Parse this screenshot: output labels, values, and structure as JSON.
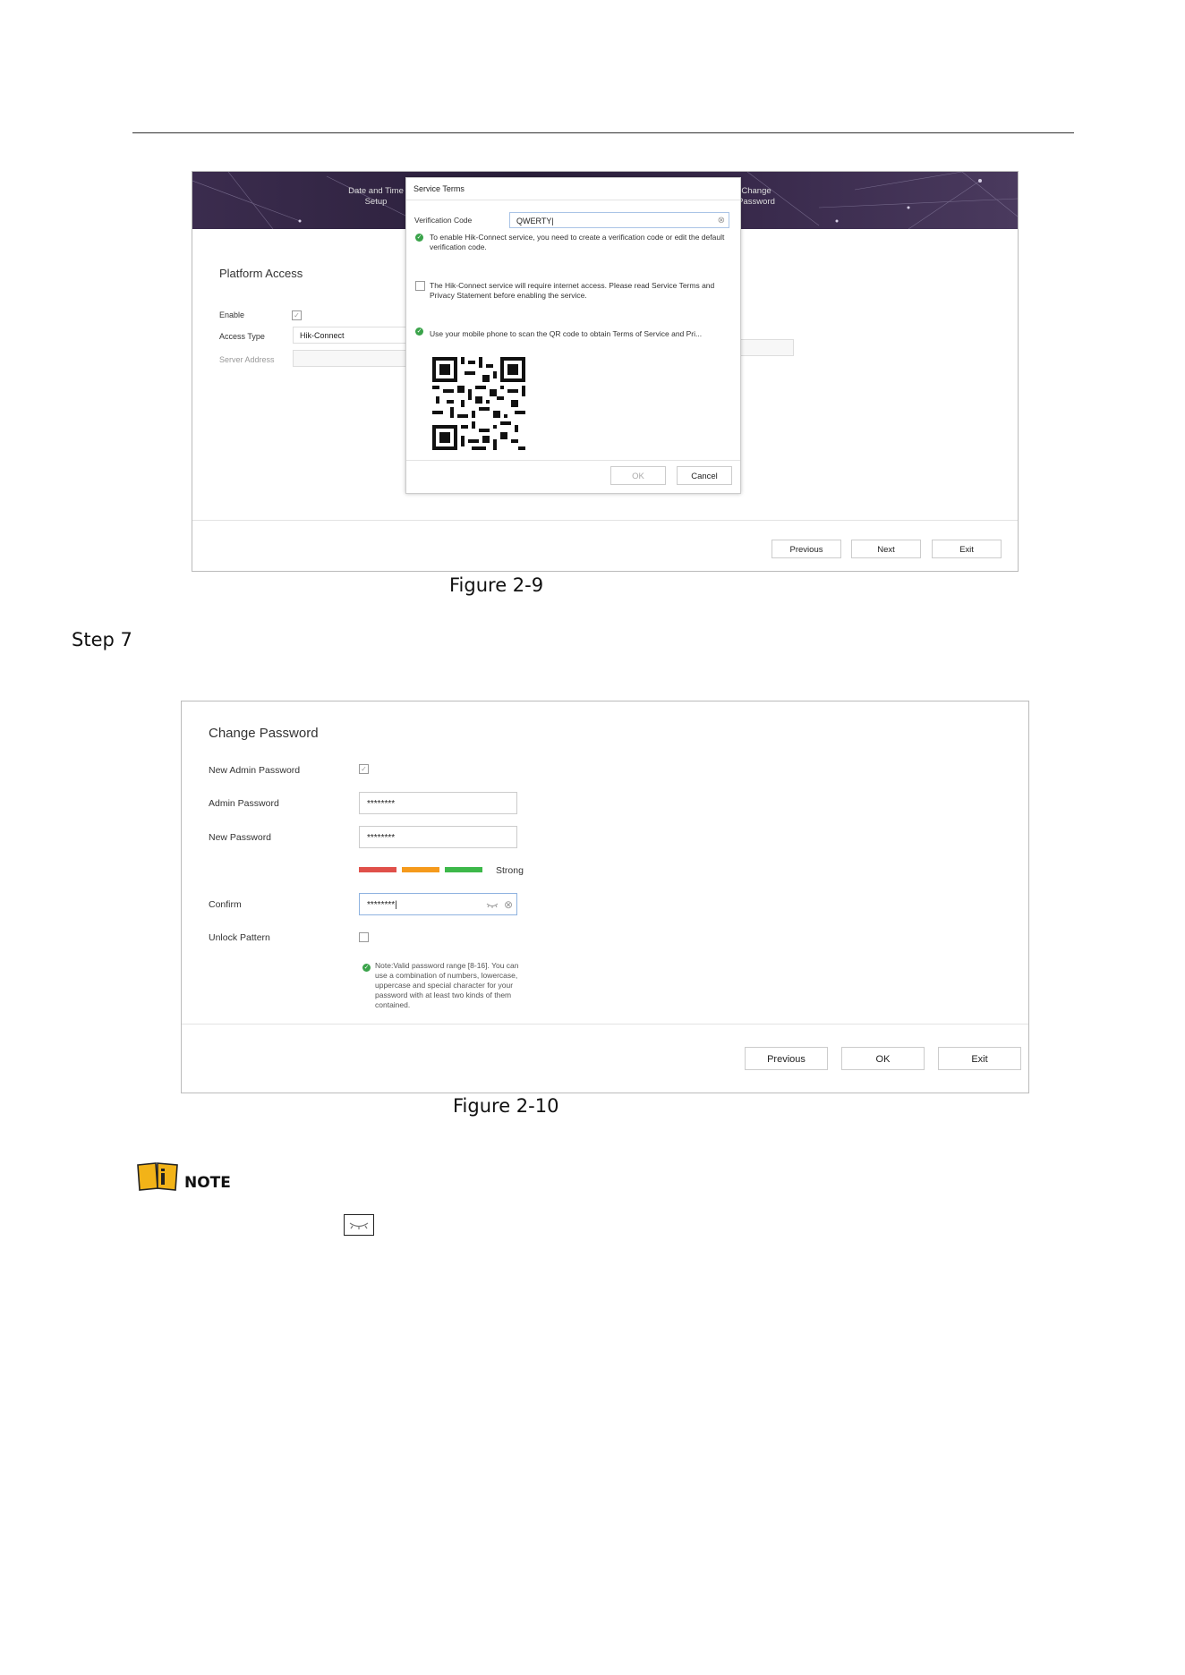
{
  "figure1": {
    "steps": [
      "Date and Time Setup",
      "Change Password"
    ],
    "section_title": "Platform Access",
    "enable_label": "Enable",
    "access_type_label": "Access Type",
    "access_type_value": "Hik-Connect",
    "server_address_label": "Server Address",
    "buttons": {
      "previous": "Previous",
      "next": "Next",
      "exit": "Exit"
    },
    "dialog": {
      "title": "Service Terms",
      "verification_code_label": "Verification Code",
      "verification_code_value": "QWERTY|",
      "msg1": "To enable Hik-Connect service, you need to create a verification code or edit the default verification code.",
      "msg2": "The Hik-Connect service will require internet access. Please read Service Terms and Privacy Statement before enabling the service.",
      "msg3": "Use your mobile phone to scan the QR code to obtain Terms of Service and Pri...",
      "ok": "OK",
      "cancel": "Cancel"
    },
    "caption": "Figure 2-9"
  },
  "step_label": "Step 7",
  "figure2": {
    "section_title": "Change Password",
    "new_admin_password_label": "New Admin Password",
    "admin_password_label": "Admin Password",
    "admin_password_value": "********",
    "new_password_label": "New Password",
    "new_password_value": "********",
    "strength_label": "Strong",
    "strength_colors": [
      "#e0504a",
      "#f59a1c",
      "#3db84a"
    ],
    "confirm_label": "Confirm",
    "confirm_value": "********|",
    "unlock_pattern_label": "Unlock Pattern",
    "note": "Note:Valid password range [8-16]. You can use a combination of numbers, lowercase, uppercase and special character for your password with at least two kinds of them contained.",
    "buttons": {
      "previous": "Previous",
      "ok": "OK",
      "exit": "Exit"
    },
    "caption": "Figure 2-10"
  },
  "note_label": "NOTE"
}
